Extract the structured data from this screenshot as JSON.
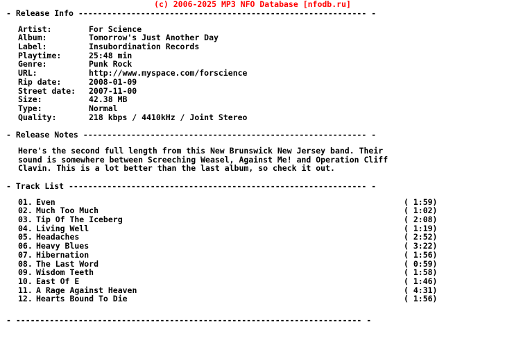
{
  "banner": {
    "text": "(c) 2006-2025 MP3 NFO Database [nfodb.ru]",
    "color": "#ff0000"
  },
  "sections": {
    "release_info": {
      "heading": "- Release Info ------------------------------------------------------------ -"
    },
    "release_notes": {
      "heading": "- Release Notes ----------------------------------------------------------- -"
    },
    "track_list": {
      "heading": "- Track List -------------------------------------------------------------- -"
    },
    "footer": {
      "rule": "- ------------------------------------------------------------------------ -"
    }
  },
  "release_info": {
    "rows": [
      {
        "label": "Artist:",
        "value": "For Science"
      },
      {
        "label": "Album:",
        "value": "Tomorrow's Just Another Day"
      },
      {
        "label": "Label:",
        "value": "Insubordination Records"
      },
      {
        "label": "Playtime:",
        "value": "25:48 min"
      },
      {
        "label": "Genre:",
        "value": "Punk Rock"
      },
      {
        "label": "URL:",
        "value": "http://www.myspace.com/forscience"
      },
      {
        "label": "Rip date:",
        "value": "2008-01-09"
      },
      {
        "label": "Street date:",
        "value": "2007-11-00"
      },
      {
        "label": "Size:",
        "value": "42.38 MB"
      },
      {
        "label": "Type:",
        "value": "Normal"
      },
      {
        "label": "Quality:",
        "value": "218 kbps / 4410kHz / Joint Stereo"
      }
    ]
  },
  "release_notes": {
    "lines": [
      "Here's the second full length from this New Brunswick New Jersey band. Their",
      "sound is somewhere between Screeching Weasel, Against Me! and Operation Cliff",
      "Clavin. This is a lot better than the last album, so check it out."
    ]
  },
  "track_list": {
    "tracks": [
      {
        "num": "01.",
        "title": "Even",
        "time": "( 1:59)"
      },
      {
        "num": "02.",
        "title": "Much Too Much",
        "time": "( 1:02)"
      },
      {
        "num": "03.",
        "title": "Tip Of The Iceberg",
        "time": "( 2:08)"
      },
      {
        "num": "04.",
        "title": "Living Well",
        "time": "( 1:19)"
      },
      {
        "num": "05.",
        "title": "Headaches",
        "time": "( 2:52)"
      },
      {
        "num": "06.",
        "title": "Heavy Blues",
        "time": "( 3:22)"
      },
      {
        "num": "07.",
        "title": "Hibernation",
        "time": "( 1:56)"
      },
      {
        "num": "08.",
        "title": "The Last Word",
        "time": "( 0:59)"
      },
      {
        "num": "09.",
        "title": "Wisdom Teeth",
        "time": "( 1:58)"
      },
      {
        "num": "10.",
        "title": "East Of E",
        "time": "( 1:46)"
      },
      {
        "num": "11.",
        "title": "A Rage Against Heaven",
        "time": "( 4:31)"
      },
      {
        "num": "12.",
        "title": "Hearts Bound To Die",
        "time": "( 1:56)"
      }
    ]
  }
}
